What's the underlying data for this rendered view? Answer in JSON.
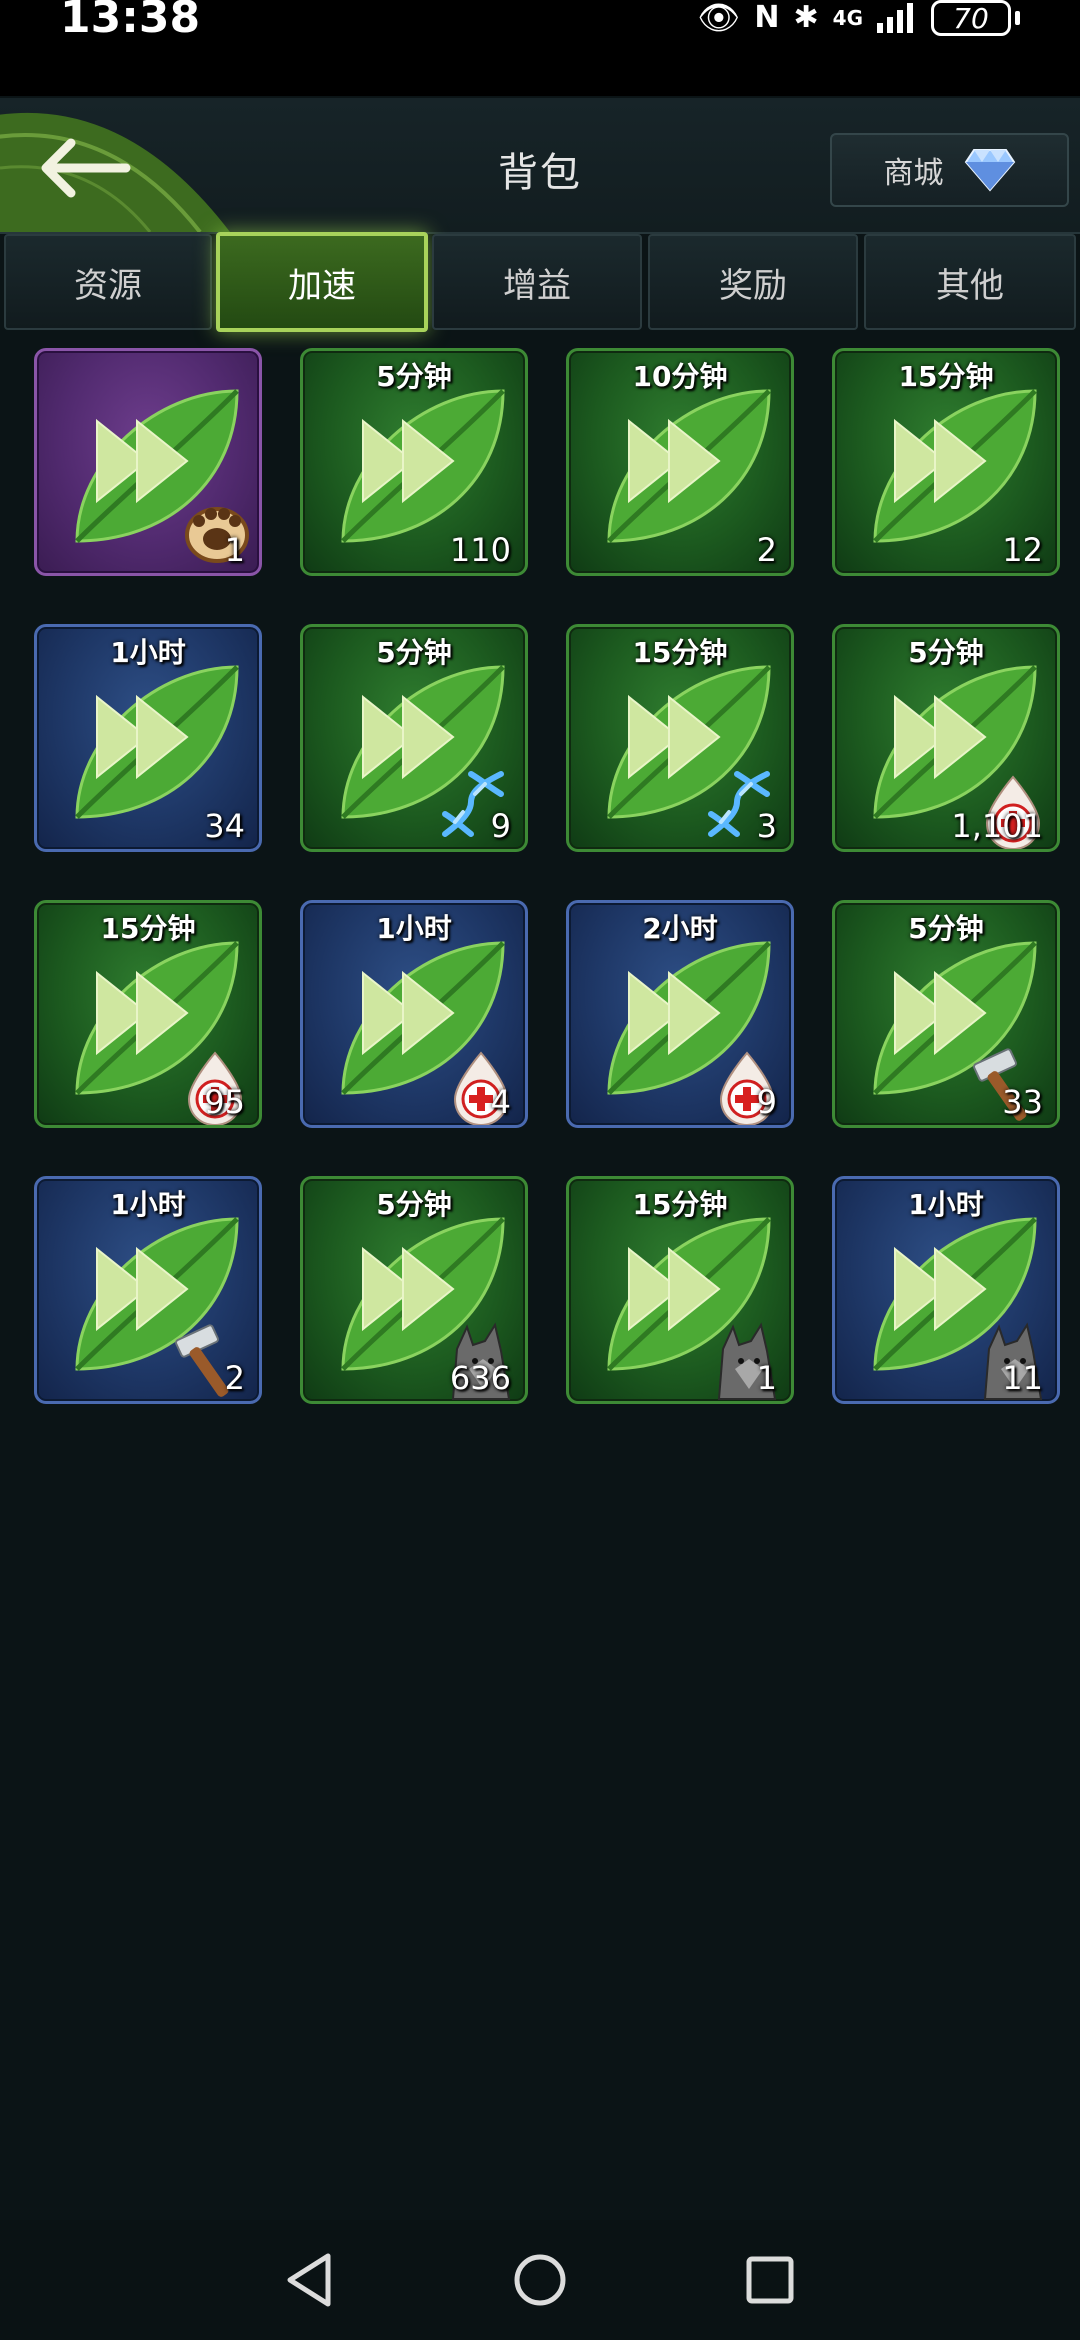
{
  "status": {
    "time": "13:38",
    "network": "4G",
    "battery": "70"
  },
  "header": {
    "title": "背包",
    "shop_label": "商城"
  },
  "tabs": [
    "资源",
    "加速",
    "增益",
    "奖励",
    "其他"
  ],
  "active_tab": 1,
  "items": [
    {
      "duration": "",
      "qty": "1",
      "frame": "purple",
      "badge": "paw"
    },
    {
      "duration": "5分钟",
      "qty": "110",
      "frame": "green",
      "badge": "none"
    },
    {
      "duration": "10分钟",
      "qty": "2",
      "frame": "green",
      "badge": "none"
    },
    {
      "duration": "15分钟",
      "qty": "12",
      "frame": "green",
      "badge": "none"
    },
    {
      "duration": "1小时",
      "qty": "34",
      "frame": "blue",
      "badge": "none"
    },
    {
      "duration": "5分钟",
      "qty": "9",
      "frame": "green",
      "badge": "dna"
    },
    {
      "duration": "15分钟",
      "qty": "3",
      "frame": "green",
      "badge": "dna"
    },
    {
      "duration": "5分钟",
      "qty": "1,101",
      "frame": "green",
      "badge": "heal"
    },
    {
      "duration": "15分钟",
      "qty": "95",
      "frame": "green",
      "badge": "heal"
    },
    {
      "duration": "1小时",
      "qty": "4",
      "frame": "blue",
      "badge": "heal"
    },
    {
      "duration": "2小时",
      "qty": "9",
      "frame": "blue",
      "badge": "heal"
    },
    {
      "duration": "5分钟",
      "qty": "33",
      "frame": "green",
      "badge": "hammer"
    },
    {
      "duration": "1小时",
      "qty": "2",
      "frame": "blue",
      "badge": "hammer"
    },
    {
      "duration": "5分钟",
      "qty": "636",
      "frame": "green",
      "badge": "wolf"
    },
    {
      "duration": "15分钟",
      "qty": "1",
      "frame": "green",
      "badge": "wolf"
    },
    {
      "duration": "1小时",
      "qty": "11",
      "frame": "blue",
      "badge": "wolf"
    }
  ],
  "colors": {
    "accent": "#a8d35b",
    "background": "#0b1416"
  }
}
